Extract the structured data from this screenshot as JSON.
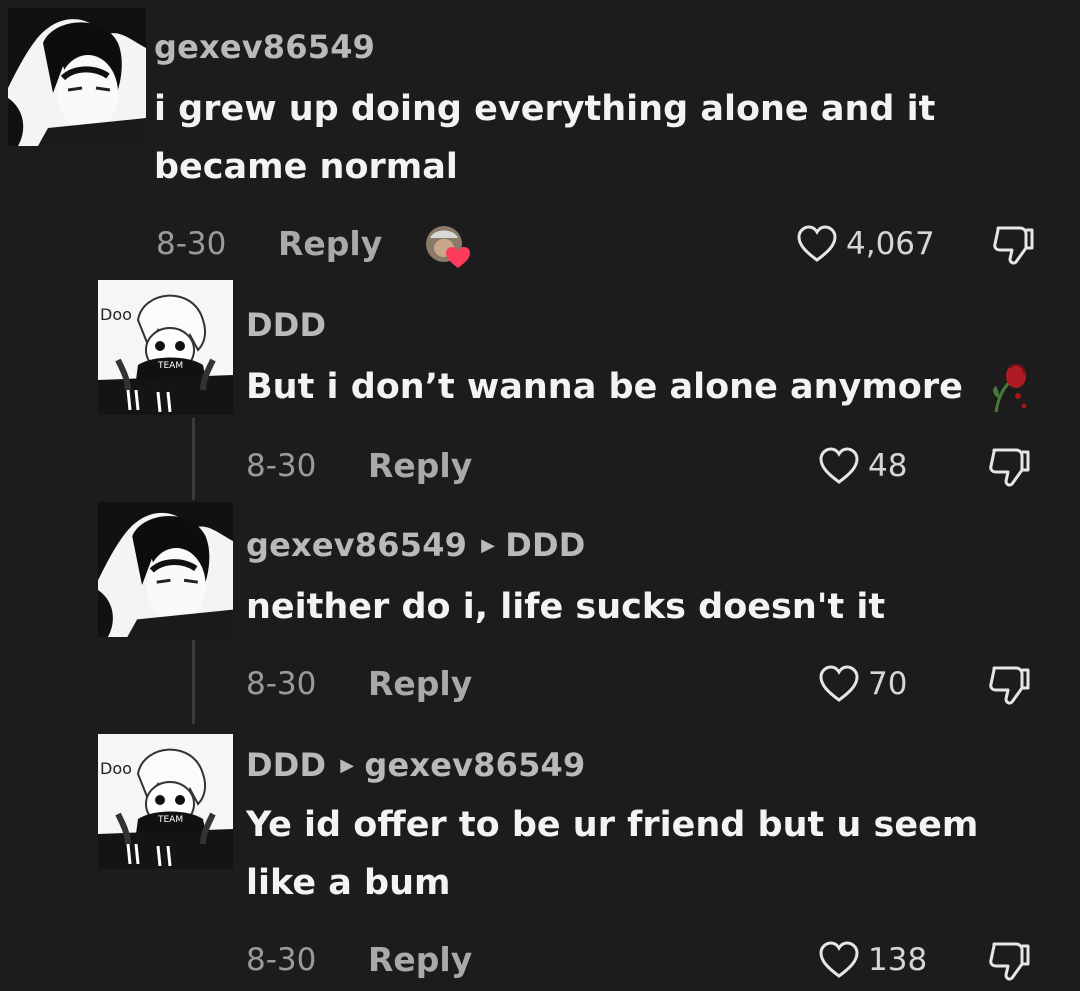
{
  "comments": [
    {
      "username": "gexev86549",
      "reply_to": "",
      "text_lines": [
        "i grew up doing everything alone and it",
        "became normal"
      ],
      "date": "8-30",
      "reply_label": "Reply",
      "likes": "4,067",
      "avatar_icon": "anime-avatar-dark-hair"
    },
    {
      "username": "DDD",
      "reply_to": "",
      "text_lines": [
        "But i don’t wanna be alone anymore"
      ],
      "date": "8-30",
      "reply_label": "Reply",
      "likes": "48",
      "avatar_icon": "anime-avatar-light-hair"
    },
    {
      "username": "gexev86549",
      "reply_to": "DDD",
      "text_lines": [
        "neither do i, life sucks doesn't it"
      ],
      "date": "8-30",
      "reply_label": "Reply",
      "likes": "70",
      "avatar_icon": "anime-avatar-dark-hair"
    },
    {
      "username": "DDD",
      "reply_to": "gexev86549",
      "text_lines": [
        "Ye id offer to be ur friend but u seem",
        "like a bum"
      ],
      "date": "8-30",
      "reply_label": "Reply",
      "likes": "138",
      "avatar_icon": "anime-avatar-light-hair"
    }
  ],
  "icons": {
    "like": "heart-outline-icon",
    "dislike": "thumbs-down-icon",
    "reply_arrow": "triangle-right-icon",
    "creator_liked": "creator-liked-heart-badge",
    "emoji": "wilted-rose-icon"
  },
  "colors": {
    "background": "#1c1c1c",
    "username": "#b9b9b9",
    "text": "#f3f3f3",
    "meta": "#9a9a9a",
    "badge_heart": "#ff3b5c"
  }
}
